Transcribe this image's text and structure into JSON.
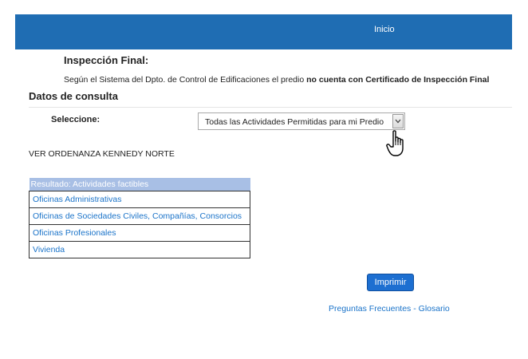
{
  "header": {
    "nav_inicio": "Inicio"
  },
  "inspection": {
    "title": "Inspección Final:",
    "text_prefix": "Según el Sistema del Dpto. de Control de Edificaciones el predio ",
    "text_bold": "no cuenta con Certificado de Inspección Final"
  },
  "consulta": {
    "title": "Datos de consulta",
    "select_label": "Seleccione:",
    "select_value": "Todas las Actividades Permitidas para mi Predio"
  },
  "ordenanza_link": "VER ORDENANZA KENNEDY NORTE",
  "results": {
    "header": "Resultado: Actividades factibles",
    "items": [
      "Oficinas Administrativas",
      "Oficinas de Sociedades Civiles, Compañías, Consorcios",
      "Oficinas Profesionales",
      "Vivienda"
    ]
  },
  "print_label": "Imprimir",
  "footer": {
    "faq": "Preguntas Frecuentes",
    "separator": " - ",
    "glossary": "Glosario"
  },
  "colors": {
    "topbar": "#1f6db3",
    "link": "#1a73c9",
    "table_header": "#a8bfe5",
    "button": "#1d6fd1"
  }
}
